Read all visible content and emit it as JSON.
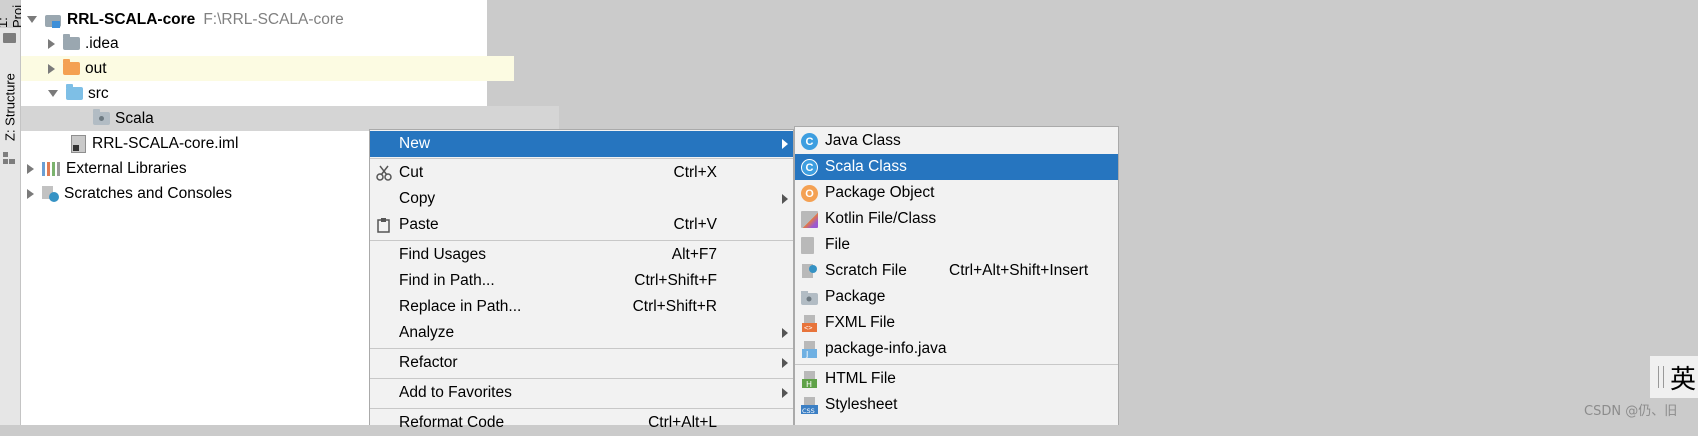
{
  "side_tabs": {
    "project": "1: Proj",
    "structure": "Z: Structure"
  },
  "project_tree": {
    "root": {
      "name": "RRL-SCALA-core",
      "path": "F:\\RRL-SCALA-core"
    },
    "items": [
      {
        "label": ".idea"
      },
      {
        "label": "out"
      },
      {
        "label": "src"
      },
      {
        "label": "Scala"
      },
      {
        "label": "RRL-SCALA-core.iml"
      },
      {
        "label": "External Libraries"
      },
      {
        "label": "Scratches and Consoles"
      }
    ]
  },
  "context_menu": {
    "items": [
      {
        "label": "New",
        "shortcut": ""
      },
      {
        "label": "Cut",
        "shortcut": "Ctrl+X"
      },
      {
        "label": "Copy",
        "shortcut": ""
      },
      {
        "label": "Paste",
        "shortcut": "Ctrl+V"
      },
      {
        "label": "Find Usages",
        "shortcut": "Alt+F7"
      },
      {
        "label": "Find in Path...",
        "shortcut": "Ctrl+Shift+F"
      },
      {
        "label": "Replace in Path...",
        "shortcut": "Ctrl+Shift+R"
      },
      {
        "label": "Analyze",
        "shortcut": ""
      },
      {
        "label": "Refactor",
        "shortcut": ""
      },
      {
        "label": "Add to Favorites",
        "shortcut": ""
      },
      {
        "label": "Reformat Code",
        "shortcut": "Ctrl+Alt+L"
      }
    ]
  },
  "new_submenu": {
    "items": [
      {
        "label": "Java Class",
        "shortcut": ""
      },
      {
        "label": "Scala Class",
        "shortcut": ""
      },
      {
        "label": "Package Object",
        "shortcut": ""
      },
      {
        "label": "Kotlin File/Class",
        "shortcut": ""
      },
      {
        "label": "File",
        "shortcut": ""
      },
      {
        "label": "Scratch File",
        "shortcut": "Ctrl+Alt+Shift+Insert"
      },
      {
        "label": "Package",
        "shortcut": ""
      },
      {
        "label": "FXML File",
        "shortcut": ""
      },
      {
        "label": "package-info.java",
        "shortcut": ""
      },
      {
        "label": "HTML File",
        "shortcut": ""
      },
      {
        "label": "Stylesheet",
        "shortcut": ""
      }
    ]
  },
  "ime": {
    "label": "英"
  },
  "watermark": "CSDN @仍、旧",
  "colors": {
    "selection": "#2675bf",
    "menu_bg": "#f2f2f2",
    "tree_selected": "#d5d5d5",
    "out_highlight": "#fcfbe2"
  }
}
